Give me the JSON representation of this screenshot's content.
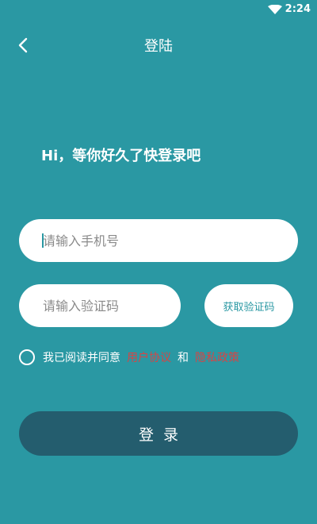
{
  "status_bar": {
    "time": "2:24",
    "wifi_icon": "wifi-icon"
  },
  "header": {
    "back_icon": "chevron-left-icon",
    "title": "登陆"
  },
  "greeting": "Hi，等你好久了快登录吧",
  "phone_input": {
    "placeholder": "请输入手机号",
    "value": ""
  },
  "code_input": {
    "placeholder": "请输入验证码",
    "value": ""
  },
  "get_code_button": {
    "label": "获取验证码"
  },
  "agreement": {
    "checked": false,
    "text": "我已阅读并同意",
    "user_agreement": "用户协议",
    "and": "和",
    "privacy_policy": "隐私政策"
  },
  "login_button": {
    "label": "登录"
  },
  "colors": {
    "background": "#2a98a3",
    "login_button": "#245d6e",
    "link": "#d64545",
    "accent": "#2a98a3"
  }
}
